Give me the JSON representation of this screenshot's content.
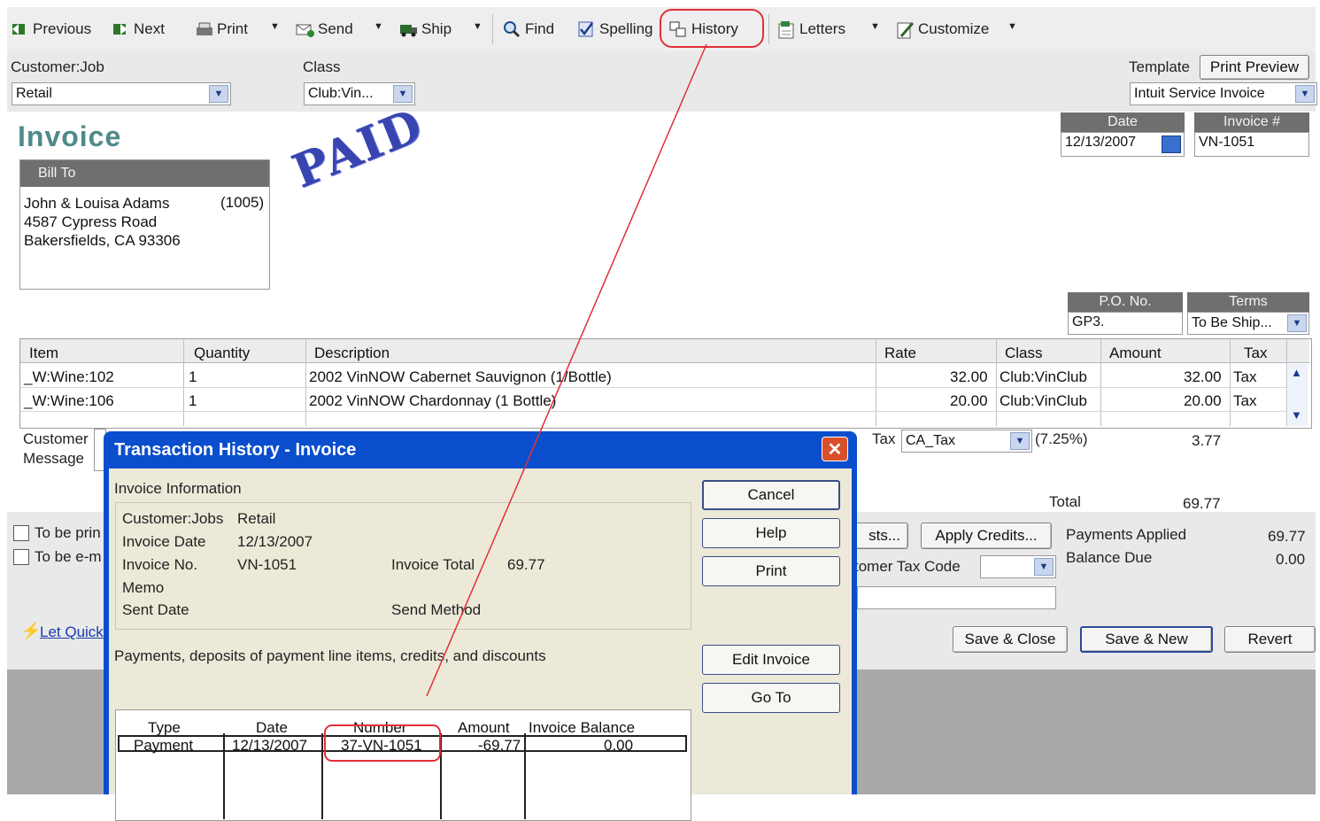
{
  "toolbar": {
    "previous": "Previous",
    "next": "Next",
    "print": "Print",
    "send": "Send",
    "ship": "Ship",
    "find": "Find",
    "spelling": "Spelling",
    "history": "History",
    "letters": "Letters",
    "customize": "Customize"
  },
  "header": {
    "customer_job_label": "Customer:Job",
    "customer_job_value": "Retail",
    "class_label": "Class",
    "class_value": "Club:Vin...",
    "template_label": "Template",
    "print_preview": "Print Preview",
    "template_value": "Intuit Service Invoice"
  },
  "form": {
    "title": "Invoice",
    "date_label": "Date",
    "date_value": "12/13/2007",
    "invoice_no_label": "Invoice #",
    "invoice_no_value": "VN-1051",
    "bill_to_label": "Bill To",
    "bill_to_lines": [
      "John & Louisa Adams",
      "4587 Cypress Road",
      "Bakersfields, CA 93306"
    ],
    "bill_to_code": "(1005)",
    "stamp": "PAID",
    "po_label": "P.O. No.",
    "po_value": "GP3.",
    "terms_label": "Terms",
    "terms_value": "To Be Ship..."
  },
  "line_items": {
    "headers": [
      "Item",
      "Quantity",
      "Description",
      "Rate",
      "Class",
      "Amount",
      "Tax"
    ],
    "rows": [
      {
        "item": "_W:Wine:102",
        "qty": "1",
        "desc": "2002 VinNOW Cabernet Sauvignon (1/Bottle)",
        "rate": "32.00",
        "class": "Club:VinClub",
        "amount": "32.00",
        "tax": "Tax"
      },
      {
        "item": "_W:Wine:106",
        "qty": "1",
        "desc": "2002 VinNOW Chardonnay (1 Bottle)",
        "rate": "20.00",
        "class": "Club:VinClub",
        "amount": "20.00",
        "tax": "Tax"
      }
    ]
  },
  "footer": {
    "customer_label": "Customer",
    "message_label": "Message",
    "tax_label": "Tax",
    "tax_item": "CA_Tax",
    "tax_rate": "(7.25%)",
    "tax_amount": "3.77",
    "total_label": "Total",
    "total_value": "69.77",
    "to_be_printed": "To be prin",
    "to_be_emailed": "To be e-m",
    "costs_button": "sts...",
    "apply_credits": "Apply Credits...",
    "customer_tax_code_label": "tomer Tax Code",
    "payments_applied_label": "Payments Applied",
    "payments_applied_value": "69.77",
    "balance_due_label": "Balance Due",
    "balance_due_value": "0.00",
    "let_quick": "Let Quick",
    "save_close": "Save & Close",
    "save_new": "Save & New",
    "revert": "Revert"
  },
  "dialog": {
    "title": "Transaction History - Invoice",
    "close_glyph": "✕",
    "info_heading": "Invoice Information",
    "customer_jobs_label": "Customer:Jobs",
    "customer_jobs_value": "Retail",
    "invoice_date_label": "Invoice Date",
    "invoice_date_value": "12/13/2007",
    "invoice_no_label": "Invoice No.",
    "invoice_no_value": "VN-1051",
    "invoice_total_label": "Invoice Total",
    "invoice_total_value": "69.77",
    "memo_label": "Memo",
    "sent_date_label": "Sent Date",
    "send_method_label": "Send Method",
    "payments_heading": "Payments, deposits of payment line items, credits, and discounts",
    "table_headers": [
      "Type",
      "Date",
      "Number",
      "Amount",
      "Invoice Balance"
    ],
    "table_rows": [
      {
        "type": "Payment",
        "date": "12/13/2007",
        "number": "37-VN-1051",
        "amount": "-69.77",
        "balance": "0.00"
      }
    ],
    "buttons": {
      "cancel": "Cancel",
      "help": "Help",
      "print": "Print",
      "edit_invoice": "Edit Invoice",
      "go_to": "Go To"
    }
  },
  "colors": {
    "dialog_title_bar": "#0a4ecd",
    "annotation_red": "#e0303a",
    "invoice_title": "#4f8a8b",
    "paid_stamp": "#2330a8"
  }
}
